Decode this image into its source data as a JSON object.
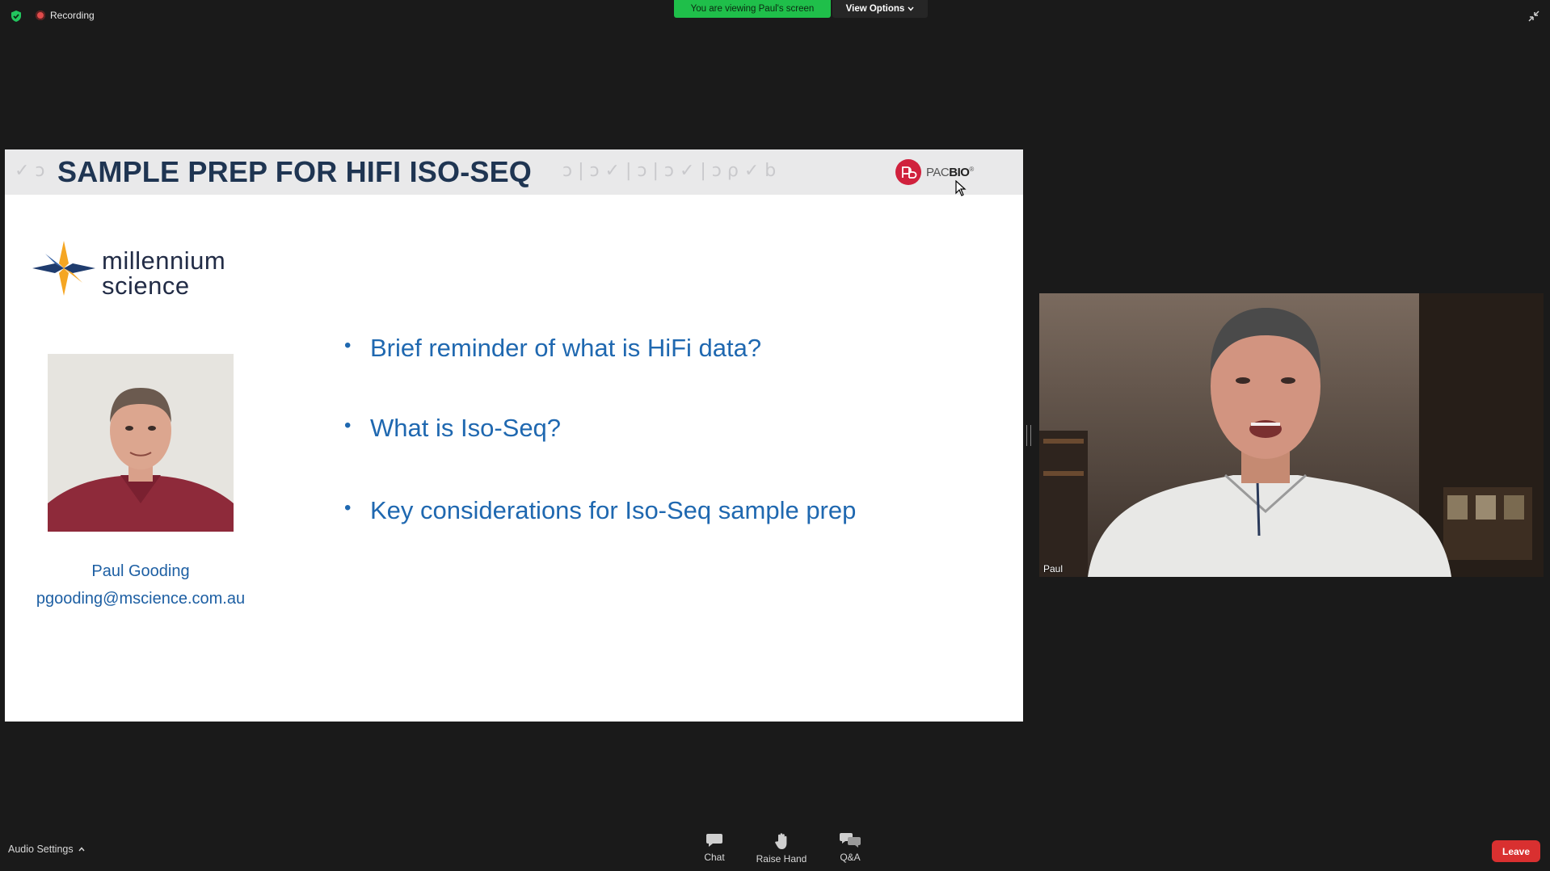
{
  "meeting": {
    "recording_label": "Recording",
    "viewing_banner": "You are viewing Paul's screen",
    "view_options_label": "View Options"
  },
  "slide": {
    "title": "SAMPLE PREP FOR HIFI ISO-SEQ",
    "pacbio_logo": {
      "prefix": "PAC",
      "suffix": "BIO"
    },
    "company_logo": {
      "line1": "millennium",
      "line2": "science"
    },
    "presenter_name": "Paul Gooding",
    "presenter_email": "pgooding@mscience.com.au",
    "bullets": [
      "Brief reminder of what is HiFi data?",
      "What is Iso-Seq?",
      "Key considerations for Iso-Seq sample prep"
    ]
  },
  "participant": {
    "name": "Paul"
  },
  "toolbar": {
    "audio_settings_label": "Audio Settings",
    "chat_label": "Chat",
    "raise_hand_label": "Raise Hand",
    "qa_label": "Q&A",
    "leave_label": "Leave"
  },
  "colors": {
    "banner_green": "#1fbf4a",
    "leave_red": "#d93030",
    "slide_title": "#1f3552",
    "slide_text_blue": "#1f68b0",
    "pacbio_red": "#d0213d"
  }
}
